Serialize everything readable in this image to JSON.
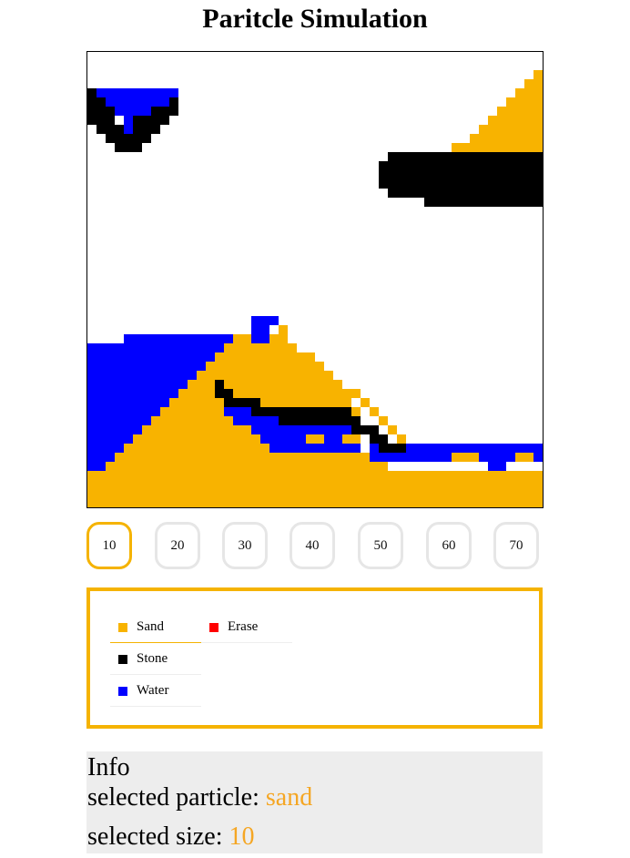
{
  "title": "Paritcle Simulation",
  "colors": {
    "sand": "#f8b300",
    "stone": "#000000",
    "water": "#0000ff",
    "erase": "#ff0000",
    "accent": "#f5b301",
    "info_value": "#f5a623"
  },
  "sizes": [
    {
      "label": "10",
      "selected": true
    },
    {
      "label": "20",
      "selected": false
    },
    {
      "label": "30",
      "selected": false
    },
    {
      "label": "40",
      "selected": false
    },
    {
      "label": "50",
      "selected": false
    },
    {
      "label": "60",
      "selected": false
    },
    {
      "label": "70",
      "selected": false
    }
  ],
  "particles": [
    {
      "label": "Sand",
      "color": "#f8b300",
      "selected": true
    },
    {
      "label": "Stone",
      "color": "#000000",
      "selected": false
    },
    {
      "label": "Water",
      "color": "#0000ff",
      "selected": false
    },
    {
      "label": "Erase",
      "color": "#ff0000",
      "selected": false
    }
  ],
  "info": {
    "heading": "Info",
    "particle_label": "selected particle: ",
    "particle_value": "sand",
    "size_label": "selected size: ",
    "size_value": "10"
  }
}
